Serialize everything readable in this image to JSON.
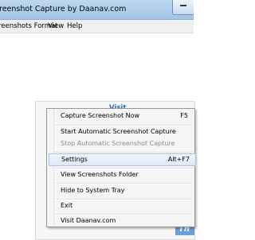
{
  "window": {
    "title": "reenshot Capture by Daanav.com"
  },
  "menubar": {
    "items": [
      "reenshots Format",
      "View",
      "Help"
    ]
  },
  "content": {
    "visit_text": "Visit",
    "logo_text": "Th"
  },
  "context_menu": {
    "items": [
      {
        "label": "Capture Screenshot Now",
        "shortcut": "F5"
      },
      {
        "label": "Start Automatic Screenshot Capture",
        "shortcut": ""
      },
      {
        "label": "Stop Automatic Screenshot Capture",
        "shortcut": ""
      },
      {
        "label": "Settings",
        "shortcut": "Alt+F7"
      },
      {
        "label": "View Screenshots Folder",
        "shortcut": ""
      },
      {
        "label": "Hide to System Tray",
        "shortcut": ""
      },
      {
        "label": "Exit",
        "shortcut": ""
      },
      {
        "label": "Visit Daanav.com",
        "shortcut": ""
      }
    ],
    "disabled_index": 2,
    "highlighted_index": 3
  },
  "colors": {
    "highlight": "#dde9f8",
    "link": "#2a6fc9",
    "disabled_text": "#8d8d8d"
  }
}
